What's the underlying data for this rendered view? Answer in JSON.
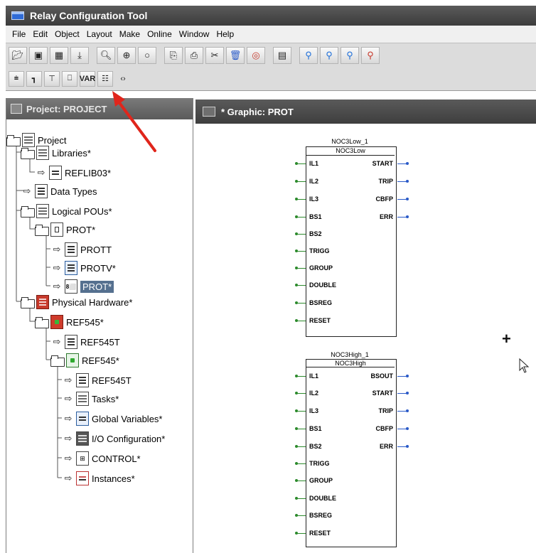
{
  "window": {
    "title": "Relay Configuration Tool"
  },
  "menu": [
    "File",
    "Edit",
    "Object",
    "Layout",
    "Make",
    "Online",
    "Window",
    "Help"
  ],
  "toolbar1": [
    "open-icon",
    "save-icon",
    "grid-icon",
    "import-icon",
    "zoom-out-icon",
    "zoom-in-icon",
    "zoom-fit-icon",
    "copy-icon",
    "paste-icon",
    "cut-icon",
    "delete-icon",
    "lifebuoy-icon",
    "calendar-icon",
    "find-icon",
    "find-next-icon",
    "find-prev-icon",
    "find-replace-icon"
  ],
  "toolbar2": {
    "buttons": [
      "wire-icon",
      "connector-icon",
      "text-icon",
      "fb-icon",
      "var-icon",
      "ladder-icon",
      "jump-icon"
    ],
    "var_label": "VAR"
  },
  "project_panel": {
    "header": "Project: PROJECT"
  },
  "tree": [
    {
      "label": "Project"
    },
    {
      "label": "Libraries*"
    },
    {
      "label": "REFLIB03*"
    },
    {
      "label": "Data Types"
    },
    {
      "label": "Logical POUs*"
    },
    {
      "label": "PROT*"
    },
    {
      "label": "PROTT"
    },
    {
      "label": "PROTV*"
    },
    {
      "label": "PROT*"
    },
    {
      "label": "Physical Hardware*"
    },
    {
      "label": "REF545*"
    },
    {
      "label": "REF545T"
    },
    {
      "label": "REF545*"
    },
    {
      "label": "REF545T"
    },
    {
      "label": "Tasks*"
    },
    {
      "label": "Global Variables*"
    },
    {
      "label": "I/O Configuration*"
    },
    {
      "label": "CONTROL*"
    },
    {
      "label": "Instances*"
    }
  ],
  "graphic_panel": {
    "header": "* Graphic: PROT"
  },
  "blocks": [
    {
      "instance": "NOC3Low_1",
      "type": "NOC3Low",
      "inputs": [
        "IL1",
        "IL2",
        "IL3",
        "BS1",
        "BS2",
        "TRIGG",
        "GROUP",
        "DOUBLE",
        "BSREG",
        "RESET"
      ],
      "outputs": [
        "START",
        "TRIP",
        "CBFP",
        "ERR"
      ]
    },
    {
      "instance": "NOC3High_1",
      "type": "NOC3High",
      "inputs": [
        "IL1",
        "IL2",
        "IL3",
        "BS1",
        "BS2",
        "TRIGG",
        "GROUP",
        "DOUBLE",
        "BSREG",
        "RESET"
      ],
      "outputs": [
        "BSOUT",
        "START",
        "TRIP",
        "CBFP",
        "ERR"
      ]
    }
  ],
  "colors": {
    "accent_selected": "#55708f",
    "input_wire": "#2c8a2c",
    "output_wire": "#2a5ac8",
    "arrow": "#e0251b"
  }
}
